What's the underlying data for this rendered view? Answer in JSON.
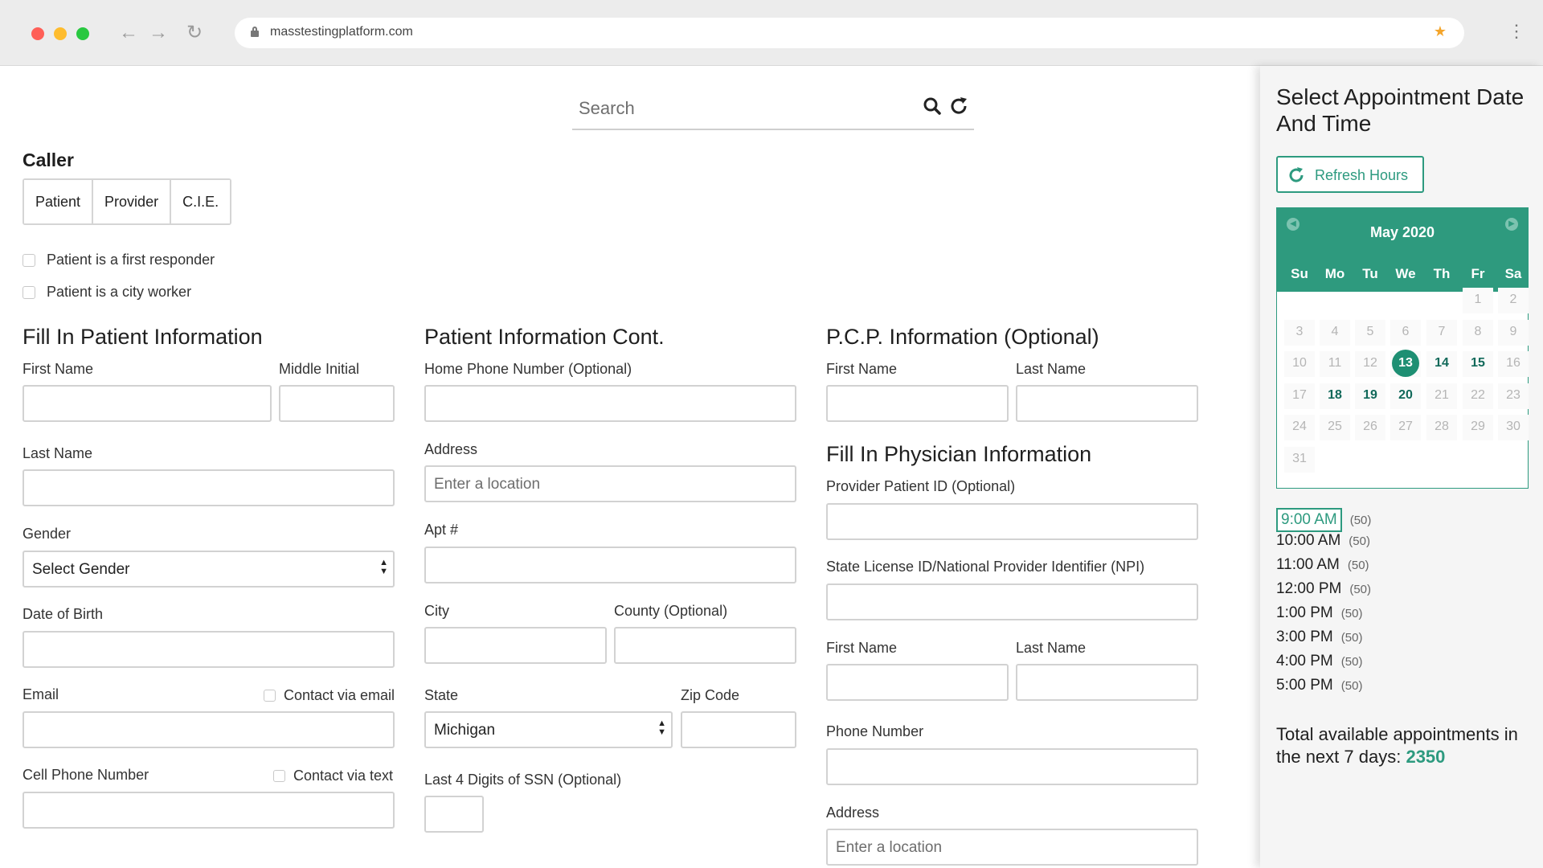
{
  "browser": {
    "url": "masstestingplatform.com",
    "dot_colors": [
      "#ff5f57",
      "#febc2e",
      "#28c840"
    ]
  },
  "search": {
    "placeholder": "Search"
  },
  "caller": {
    "title": "Caller",
    "options": [
      "Patient",
      "Provider",
      "C.I.E."
    ],
    "checkboxes": [
      "Patient is a first responder",
      "Patient is a city worker"
    ]
  },
  "patient": {
    "title": "Fill In Patient Information",
    "first_name": "First Name",
    "middle_initial": "Middle Initial",
    "last_name": "Last Name",
    "gender": "Gender",
    "gender_value": "Select Gender",
    "dob": "Date of Birth",
    "email": "Email",
    "contact_email": "Contact via email",
    "cell": "Cell Phone Number",
    "contact_text": "Contact via text"
  },
  "patient_cont": {
    "title": "Patient Information Cont.",
    "home_phone": "Home Phone Number (Optional)",
    "address": "Address",
    "address_placeholder": "Enter a location",
    "apt": "Apt #",
    "city": "City",
    "county": "County (Optional)",
    "state": "State",
    "state_value": "Michigan",
    "zip": "Zip Code",
    "ssn": "Last 4 Digits of SSN (Optional)"
  },
  "pcp": {
    "title": "P.C.P. Information (Optional)",
    "first_name": "First Name",
    "last_name": "Last Name"
  },
  "physician": {
    "title": "Fill In Physician Information",
    "provider_id": "Provider Patient ID (Optional)",
    "license": "State License ID/National Provider Identifier (NPI)",
    "first_name": "First Name",
    "last_name": "Last Name",
    "phone": "Phone Number",
    "address": "Address",
    "address_placeholder": "Enter a location"
  },
  "appointment": {
    "title": "Select Appointment Date And Time",
    "refresh_label": "Refresh Hours",
    "accent": "#2d9a7f",
    "calendar": {
      "month": "May 2020",
      "weekdays": [
        "Su",
        "Mo",
        "Tu",
        "We",
        "Th",
        "Fr",
        "Sa"
      ],
      "first_weekday": 5,
      "days_in_month": 31,
      "available": [
        13,
        14,
        15,
        18,
        19,
        20
      ],
      "selected": 13
    },
    "slots": [
      {
        "time": "9:00 AM",
        "count": "(50)",
        "selected": true
      },
      {
        "time": "10:00 AM",
        "count": "(50)"
      },
      {
        "time": "11:00 AM",
        "count": "(50)"
      },
      {
        "time": "12:00 PM",
        "count": "(50)"
      },
      {
        "time": "1:00 PM",
        "count": "(50)"
      },
      {
        "time": "3:00 PM",
        "count": "(50)"
      },
      {
        "time": "4:00 PM",
        "count": "(50)"
      },
      {
        "time": "5:00 PM",
        "count": "(50)"
      }
    ],
    "total_label": "Total available appointments in the next 7 days:",
    "total_value": "2350"
  }
}
